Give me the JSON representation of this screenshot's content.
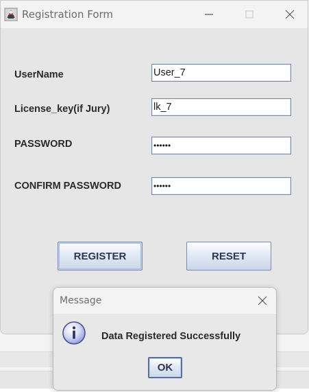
{
  "window": {
    "title": "Registration Form",
    "icon": "java-app-icon"
  },
  "form": {
    "fields": [
      {
        "label": "UserName",
        "value": "User_7"
      },
      {
        "label": "License_key(if Jury)",
        "value": "lk_7"
      },
      {
        "label": "PASSWORD",
        "value": "••••••"
      },
      {
        "label": "CONFIRM PASSWORD",
        "value": "••••••"
      }
    ],
    "register_label": "REGISTER",
    "reset_label": "RESET"
  },
  "dialog": {
    "title": "Message",
    "message": "Data Registered Successfully",
    "ok_label": "OK",
    "icon": "info-icon"
  },
  "colors": {
    "button_border": "#7b8ba8",
    "button_text": "#2b3650",
    "field_border": "#7a8aa0",
    "info_icon": "#8a92d6"
  }
}
